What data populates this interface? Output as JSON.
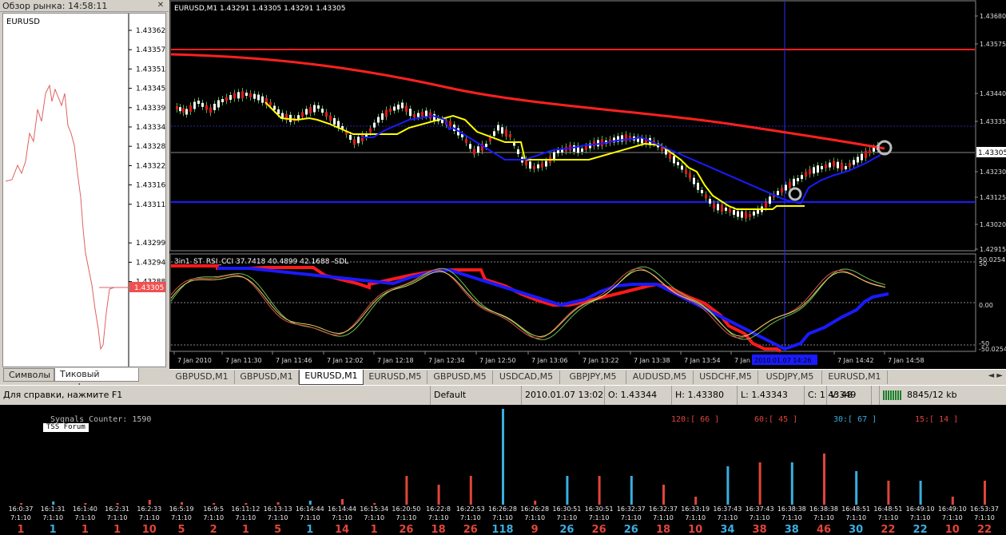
{
  "market_watch": {
    "title": "Обзор рынка: 14:58:11",
    "close_icon": "close-icon",
    "chart_title": "EURUSD",
    "current_price": "1.43305",
    "price_labels": [
      "1.43362",
      "1.43357",
      "1.43351",
      "1.43345",
      "1.43339",
      "1.43334",
      "1.43328",
      "1.43322",
      "1.43316",
      "1.43311",
      "1.43305",
      "1.43299",
      "1.43294",
      "1.43288"
    ],
    "tabs": [
      "Символы",
      "Тиковый график"
    ],
    "active_tab": 1
  },
  "chart": {
    "header": "EURUSD,M1  1.43291 1.43305 1.43291 1.43305",
    "price_labels": [
      "1.43680",
      "1.43575",
      "1.43440",
      "1.43335",
      "1.43230",
      "1.43125",
      "1.43020",
      "1.42915"
    ],
    "current_price": "1.43305",
    "indicator_header": "3in1_ST_RSI_CCI 37.7418 40.4899 42.1688 -SDL",
    "indicator_labels": [
      "50.0254",
      "50",
      "0.00",
      "-50",
      "-50.0254"
    ],
    "time_labels": [
      "7 Jan 2010",
      "7 Jan 11:30",
      "7 Jan 11:46",
      "7 Jan 12:02",
      "7 Jan 12:18",
      "7 Jan 12:34",
      "7 Jan 12:50",
      "7 Jan 13:06",
      "7 Jan 13:22",
      "7 Jan 13:38",
      "7 Jan 13:54",
      "7 Jan",
      "7 Jan 14:42",
      "7 Jan 14:58"
    ],
    "crosshair_label": "2010.01.07 14:26",
    "colors": {
      "ma": "#ff2020",
      "support": "#1a1aff",
      "trail": "#ffff00"
    }
  },
  "chart_tabs": {
    "items": [
      "GBPUSD,M1",
      "GBPUSD,M1",
      "EURUSD,M1",
      "EURUSD,M5",
      "GBPUSD,M5",
      "USDCAD,M5",
      "GBPJPY,M5",
      "AUDUSD,M5",
      "USDCHF,M5",
      "USDJPY,M5",
      "EURUSD,M1"
    ],
    "active": 2
  },
  "status": {
    "help": "Для справки, нажмите F1",
    "profile": "Default",
    "datetime": "2010.01.07 13:02",
    "open": "O: 1.43344",
    "high": "H: 1.43380",
    "low": "L: 1.43343",
    "close": "C: 1.43349",
    "volume": "V: 48",
    "traffic": "8845/12 kb"
  },
  "signals": {
    "counter": "Syqnals Counter: 1590",
    "forum": "TSS Forum",
    "tf_labels": [
      {
        "text": "120:[ 66 ]",
        "color": "#e0453a"
      },
      {
        "text": "60:[ 45 ]",
        "color": "#e0453a"
      },
      {
        "text": "30:[ 67 ]",
        "color": "#3aaee0"
      },
      {
        "text": "15:[ 14 ]",
        "color": "#e0453a"
      }
    ],
    "columns": [
      {
        "time": "16:0:37",
        "tf": "7:1:10",
        "count": "1",
        "color": "#e0453a",
        "h": 2
      },
      {
        "time": "16:1:31",
        "tf": "7:1:10",
        "count": "1",
        "color": "#3aaee0",
        "h": 4
      },
      {
        "time": "16:1:40",
        "tf": "7:1:10",
        "count": "1",
        "color": "#e0453a",
        "h": 2
      },
      {
        "time": "16:2:31",
        "tf": "7:1:10",
        "count": "1",
        "color": "#e0453a",
        "h": 2
      },
      {
        "time": "16:2:33",
        "tf": "7:1:10",
        "count": "10",
        "color": "#e0453a",
        "h": 6
      },
      {
        "time": "16:5:19",
        "tf": "7:1:10",
        "count": "5",
        "color": "#e0453a",
        "h": 3
      },
      {
        "time": "16:9:5",
        "tf": "7:1:10",
        "count": "2",
        "color": "#e0453a",
        "h": 2
      },
      {
        "time": "16:11:12",
        "tf": "7:1:10",
        "count": "1",
        "color": "#e0453a",
        "h": 2
      },
      {
        "time": "16:13:13",
        "tf": "7:1:10",
        "count": "5",
        "color": "#e0453a",
        "h": 3
      },
      {
        "time": "16:14:44",
        "tf": "7:1:10",
        "count": "1",
        "color": "#3aaee0",
        "h": 5
      },
      {
        "time": "16:14:44",
        "tf": "7:1:10",
        "count": "14",
        "color": "#e0453a",
        "h": 7
      },
      {
        "time": "16:15:34",
        "tf": "7:1:10",
        "count": "1",
        "color": "#e0453a",
        "h": 2
      },
      {
        "time": "16:20:50",
        "tf": "7:1:10",
        "count": "26",
        "color": "#e0453a",
        "h": 36
      },
      {
        "time": "16:22:8",
        "tf": "7:1:10",
        "count": "18",
        "color": "#e0453a",
        "h": 25
      },
      {
        "time": "16:22:53",
        "tf": "7:1:10",
        "count": "26",
        "color": "#e0453a",
        "h": 36
      },
      {
        "time": "16:26:28",
        "tf": "7:1:10",
        "count": "118",
        "color": "#3aaee0",
        "h": 120
      },
      {
        "time": "16:26:28",
        "tf": "7:1:10",
        "count": "9",
        "color": "#e0453a",
        "h": 5
      },
      {
        "time": "16:30:51",
        "tf": "7:1:10",
        "count": "26",
        "color": "#3aaee0",
        "h": 36
      },
      {
        "time": "16:30:51",
        "tf": "7:1:10",
        "count": "26",
        "color": "#e0453a",
        "h": 36
      },
      {
        "time": "16:32:37",
        "tf": "7:1:10",
        "count": "26",
        "color": "#3aaee0",
        "h": 36
      },
      {
        "time": "16:32:37",
        "tf": "7:1:10",
        "count": "18",
        "color": "#e0453a",
        "h": 25
      },
      {
        "time": "16:33:19",
        "tf": "7:1:10",
        "count": "10",
        "color": "#e0453a",
        "h": 10
      },
      {
        "time": "16:37:43",
        "tf": "7:1:10",
        "count": "34",
        "color": "#3aaee0",
        "h": 48
      },
      {
        "time": "16:37:43",
        "tf": "7:1:10",
        "count": "38",
        "color": "#e0453a",
        "h": 53
      },
      {
        "time": "16:38:38",
        "tf": "7:1:10",
        "count": "38",
        "color": "#3aaee0",
        "h": 53
      },
      {
        "time": "16:38:38",
        "tf": "7:1:10",
        "count": "46",
        "color": "#e0453a",
        "h": 64
      },
      {
        "time": "16:48:51",
        "tf": "7:1:10",
        "count": "30",
        "color": "#3aaee0",
        "h": 42
      },
      {
        "time": "16:48:51",
        "tf": "7:1:10",
        "count": "22",
        "color": "#e0453a",
        "h": 30
      },
      {
        "time": "16:49:10",
        "tf": "7:1:10",
        "count": "22",
        "color": "#3aaee0",
        "h": 30
      },
      {
        "time": "16:49:10",
        "tf": "7:1:10",
        "count": "10",
        "color": "#e0453a",
        "h": 10
      },
      {
        "time": "16:53:37",
        "tf": "7:1:10",
        "count": "22",
        "color": "#e0453a",
        "h": 30
      }
    ]
  }
}
